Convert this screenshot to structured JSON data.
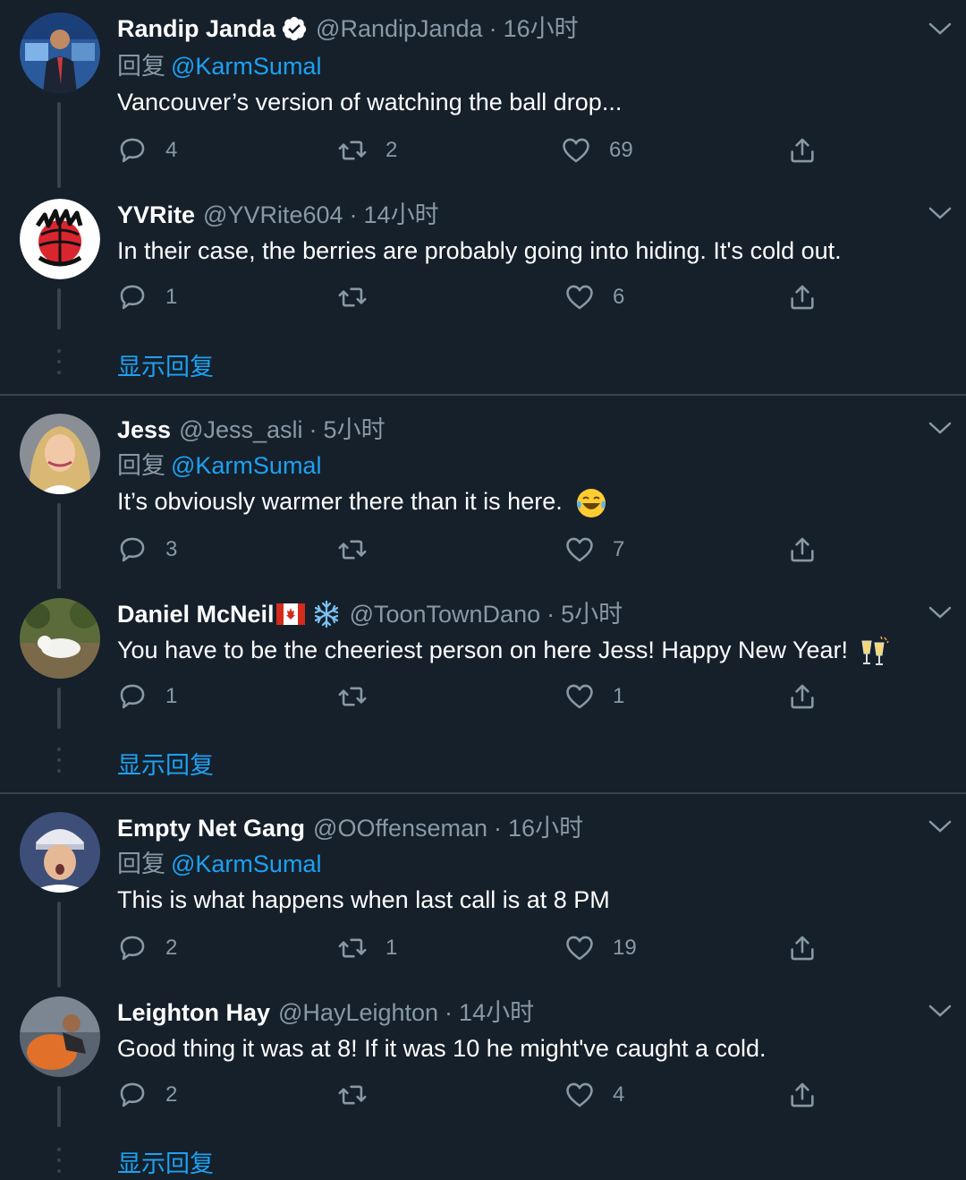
{
  "threads": [
    {
      "tweets": [
        {
          "name": "Randip Janda",
          "handle": "@RandipJanda",
          "time": "16小时",
          "reply_prefix": "回复",
          "reply_to": "@KarmSumal",
          "text": "Vancouver’s version of watching the ball drop...",
          "replies": "4",
          "retweets": "2",
          "likes": "69"
        },
        {
          "name": "YVRite",
          "handle": "@YVRite604",
          "time": "14小时",
          "text": "In their case, the berries are probably going into hiding. It's cold out.",
          "replies": "1",
          "retweets": "",
          "likes": "6"
        }
      ],
      "show_replies": "显示回复"
    },
    {
      "tweets": [
        {
          "name": "Jess",
          "handle": "@Jess_asli",
          "time": "5小时",
          "reply_prefix": "回复",
          "reply_to": "@KarmSumal",
          "text": "It’s obviously warmer there than it is here.",
          "replies": "3",
          "retweets": "",
          "likes": "7"
        },
        {
          "name": "Daniel McNeil",
          "handle": "@ToonTownDano",
          "time": "5小时",
          "text": "You have to be the cheeriest person on here Jess! Happy New Year!",
          "replies": "1",
          "retweets": "",
          "likes": "1"
        }
      ],
      "show_replies": "显示回复"
    },
    {
      "tweets": [
        {
          "name": "Empty Net Gang",
          "handle": "@OOffenseman",
          "time": "16小时",
          "reply_prefix": "回复",
          "reply_to": "@KarmSumal",
          "text": "This is what happens when last call is at 8 PM",
          "replies": "2",
          "retweets": "1",
          "likes": "19"
        },
        {
          "name": "Leighton Hay",
          "handle": "@HayLeighton",
          "time": "14小时",
          "text": "Good thing it was at 8! If it was 10 he might've caught a cold.",
          "replies": "2",
          "retweets": "",
          "likes": "4"
        }
      ],
      "show_replies": "显示回复"
    }
  ],
  "colors": {
    "background": "#15202b",
    "secondary_text": "#8899a6",
    "accent": "#1da1f2",
    "divider": "#38444d"
  }
}
